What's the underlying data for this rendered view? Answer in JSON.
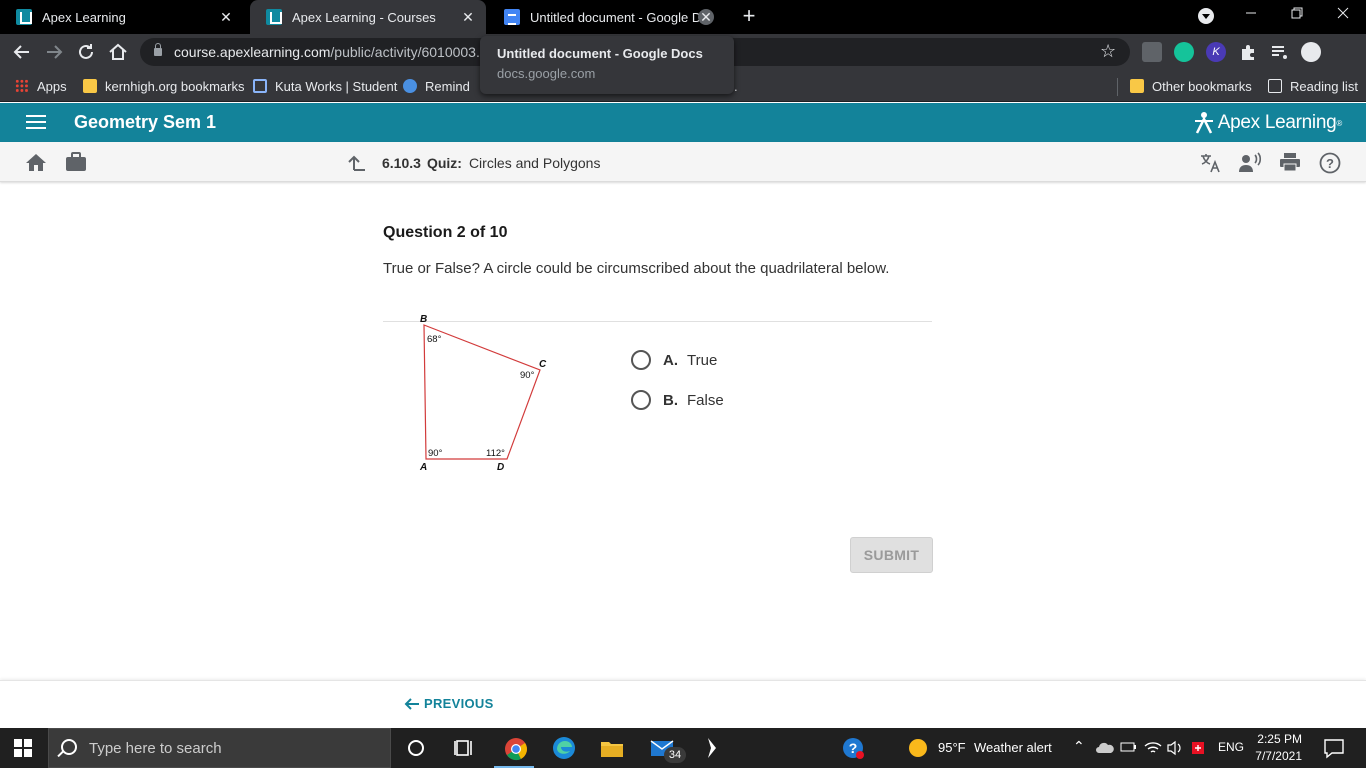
{
  "browser": {
    "tabs": [
      {
        "title": "Apex Learning",
        "favicon": "apex-favicon",
        "active": false
      },
      {
        "title": "Apex Learning - Courses",
        "favicon": "apex-favicon",
        "active": true
      },
      {
        "title": "Untitled document - Google Doc",
        "favicon": "docs-favicon",
        "active": false
      }
    ],
    "tab_close_glyph": "✕",
    "new_tab_glyph": "+",
    "url_host": "course.apexlearning.com",
    "url_path": "/public/activity/6010003...",
    "hovercard": {
      "title": "Untitled document - Google Docs",
      "domain": "docs.google.com"
    },
    "bookmarks": [
      "Apps",
      "kernhigh.org bookmarks",
      "Kuta Works | Student",
      "Remind",
      "Other bookmarks",
      "Reading list"
    ],
    "bookmark_trailing": "."
  },
  "app": {
    "course_title": "Geometry Sem 1",
    "brand": "Apex Learning",
    "brand_mark": "®",
    "activity_number": "6.10.3",
    "activity_type": "Quiz:",
    "activity_name": "Circles and Polygons"
  },
  "question": {
    "heading": "Question 2 of 10",
    "text": "True or False? A circle could be circumscribed about the quadrilateral below.",
    "figure": {
      "vertices": [
        "B",
        "C",
        "A",
        "D"
      ],
      "angles": {
        "B": "68°",
        "C": "90°",
        "A": "90°",
        "D": "112°"
      },
      "stroke_color": "#d23b3b"
    },
    "options": [
      {
        "letter": "A.",
        "label": "True"
      },
      {
        "letter": "B.",
        "label": "False"
      }
    ],
    "submit_label": "SUBMIT"
  },
  "footer": {
    "previous_label": "PREVIOUS"
  },
  "taskbar": {
    "search_placeholder": "Type here to search",
    "mail_badge": "34",
    "weather": "95°F",
    "weather_alert": "Weather alert",
    "language": "ENG",
    "time": "2:25 PM",
    "date": "7/7/2021"
  },
  "colors": {
    "accent": "#13839a",
    "chrome_dark": "#35363a",
    "taskbar": "#202020"
  }
}
